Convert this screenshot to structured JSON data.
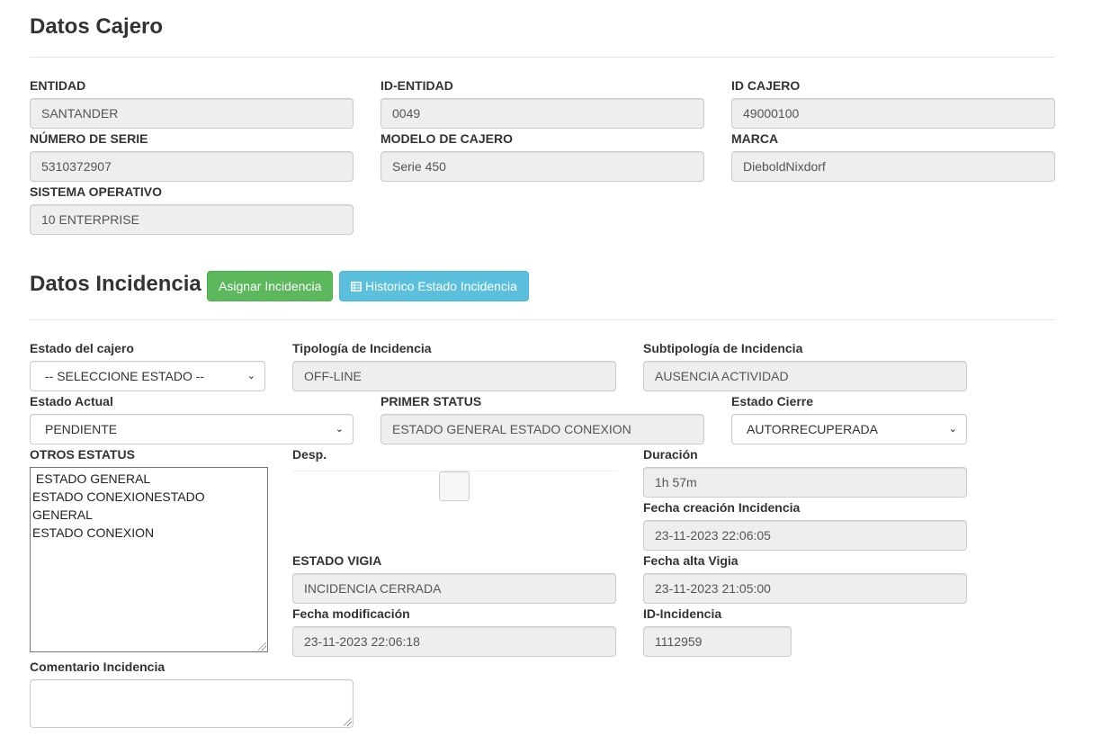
{
  "cajero": {
    "title": "Datos Cajero",
    "entidad": {
      "label": "ENTIDAD",
      "value": "SANTANDER"
    },
    "id_entidad": {
      "label": "ID-ENTIDAD",
      "value": "0049"
    },
    "id_cajero": {
      "label": "ID CAJERO",
      "value": "49000100"
    },
    "numero_serie": {
      "label": "NÚMERO DE SERIE",
      "value": "5310372907"
    },
    "modelo": {
      "label": "MODELO DE CAJERO",
      "value": "Serie 450"
    },
    "marca": {
      "label": "MARCA",
      "value": "DieboldNixdorf"
    },
    "sistema_operativo": {
      "label": "SISTEMA OPERATIVO",
      "value": "10 ENTERPRISE"
    }
  },
  "incidencia": {
    "title": "Datos Incidencia",
    "asignar_button": "Asignar Incidencia",
    "historico_button": "Historico Estado Incidencia",
    "estado_cajero": {
      "label": "Estado del cajero",
      "value": "-- SELECCIONE ESTADO --"
    },
    "tipologia": {
      "label": "Tipología de Incidencia",
      "value": "OFF-LINE"
    },
    "subtipologia": {
      "label": "Subtipología de Incidencia",
      "value": "AUSENCIA ACTIVIDAD"
    },
    "estado_actual": {
      "label": "Estado Actual",
      "value": "PENDIENTE"
    },
    "primer_status": {
      "label": "PRIMER STATUS",
      "value": "ESTADO GENERAL ESTADO CONEXION"
    },
    "estado_cierre": {
      "label": "Estado Cierre",
      "value": "AUTORRECUPERADA"
    },
    "otros_estatus": {
      "label": "OTROS ESTATUS",
      "options": [
        " ESTADO GENERAL",
        "ESTADO CONEXIONESTADO",
        "GENERAL",
        "ESTADO CONEXION"
      ]
    },
    "desp": {
      "label": "Desp."
    },
    "duracion": {
      "label": "Duración",
      "value": "1h 57m"
    },
    "fecha_creacion": {
      "label": "Fecha creación Incidencia",
      "value": "23-11-2023 22:06:05"
    },
    "estado_vigia": {
      "label": "ESTADO VIGIA",
      "value": "INCIDENCIA CERRADA"
    },
    "fecha_alta_vigia": {
      "label": "Fecha alta Vigia",
      "value": "23-11-2023 21:05:00"
    },
    "fecha_modificacion": {
      "label": "Fecha modificación",
      "value": "23-11-2023 22:06:18"
    },
    "id_incidencia": {
      "label": "ID-Incidencia",
      "value": "1112959"
    },
    "comentario": {
      "label": "Comentario Incidencia"
    }
  },
  "colors": {
    "success": "#5cb85c",
    "info": "#5bc0de",
    "readonly_bg": "#eeeeee"
  }
}
